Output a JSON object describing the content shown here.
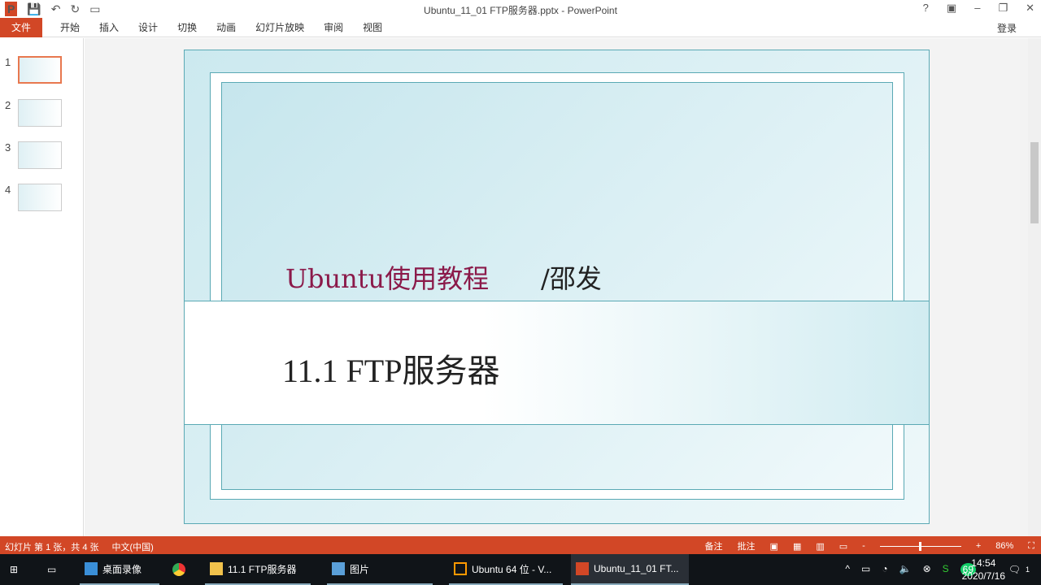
{
  "window": {
    "title": "Ubuntu_11_01 FTP服务器.pptx - PowerPoint",
    "app_icon": "P",
    "login": "登录",
    "controls": [
      "?",
      "▣",
      "–",
      "❐",
      "✕"
    ]
  },
  "qat": [
    "save-icon",
    "undo-icon",
    "redo-icon",
    "present-icon"
  ],
  "ribbon": {
    "tabs": [
      "文件",
      "开始",
      "插入",
      "设计",
      "切换",
      "动画",
      "幻灯片放映",
      "审阅",
      "视图"
    ]
  },
  "thumbnails": [
    "1",
    "2",
    "3",
    "4"
  ],
  "slide": {
    "subtitle": "Ubuntu使用教程",
    "author": "/邵发",
    "title": "11.1 FTP服务器"
  },
  "status": {
    "slide_info": "幻灯片 第 1 张，共 4 张",
    "language": "中文(中国)",
    "notes": "备注",
    "comments": "批注",
    "zoom": "86%",
    "zoom_fraction": 0.5
  },
  "taskbar": {
    "items": [
      "桌面录像",
      "11.1 FTP服务器",
      "图片",
      "Ubuntu 64 位 - V...",
      "Ubuntu_11_01 FT..."
    ],
    "time": "14:54",
    "date": "2020/7/16",
    "badge": "69",
    "notif": "1"
  }
}
